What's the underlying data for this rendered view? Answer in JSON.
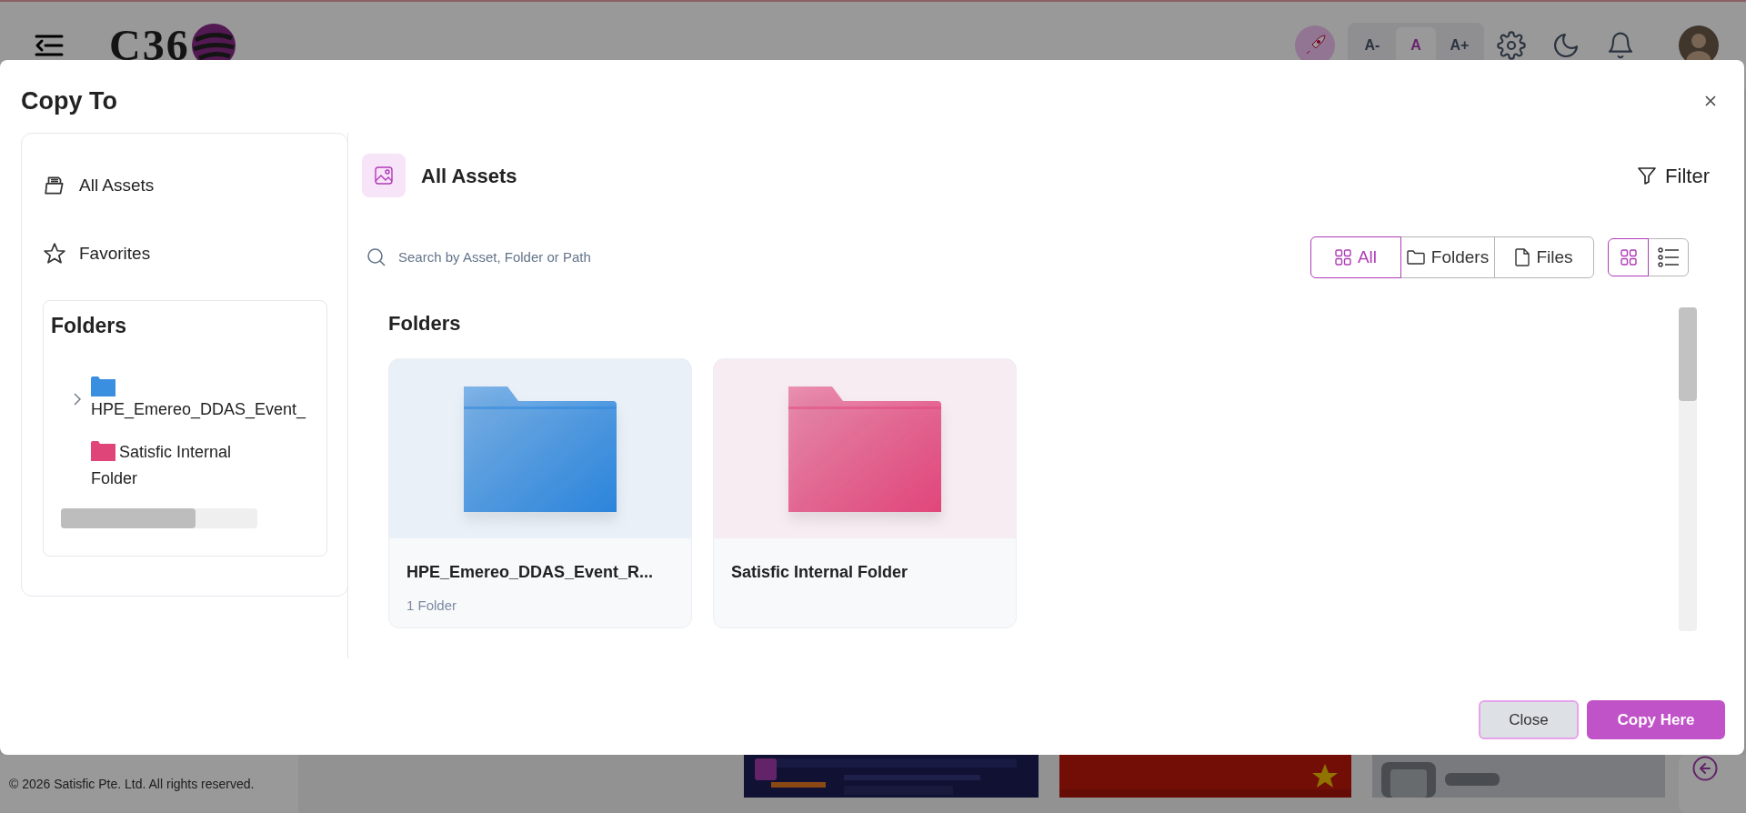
{
  "header": {
    "logo_text": "C36",
    "font_sizes": [
      {
        "label": "A-",
        "selected": false
      },
      {
        "label": "A",
        "selected": true
      },
      {
        "label": "A+",
        "selected": false
      }
    ]
  },
  "dialog": {
    "title": "Copy To",
    "sidebar": {
      "items": [
        {
          "label": "All Assets",
          "kind": "assets"
        },
        {
          "label": "Favorites",
          "kind": "favorites"
        }
      ],
      "folders_title": "Folders",
      "tree": [
        {
          "name": "HPE_Emereo_DDAS_Event_",
          "color": "#3b8fe0",
          "expandable": true
        },
        {
          "name": "Satisfic Internal Folder",
          "color": "#e0457a",
          "expandable": false
        }
      ]
    },
    "main": {
      "title": "All Assets",
      "filter": "Filter",
      "search": {
        "placeholder": "Search by Asset, Folder or Path"
      },
      "type_filters": [
        {
          "label": "All",
          "kind": "all",
          "selected": true
        },
        {
          "label": "Folders",
          "kind": "folders",
          "selected": false
        },
        {
          "label": "Files",
          "kind": "files",
          "selected": false
        }
      ],
      "view_modes": [
        {
          "kind": "grid",
          "selected": true
        },
        {
          "kind": "list",
          "selected": false
        }
      ],
      "section_title": "Folders",
      "folders": [
        {
          "name": "HPE_Emereo_DDAS_Event_R...",
          "subtitle": "1 Folder",
          "color": "#2a84db"
        },
        {
          "name": "Satisfic Internal Folder",
          "color": "#e0457a"
        }
      ]
    },
    "buttons": [
      {
        "label": "Close",
        "kind": "secondary"
      },
      {
        "label": "Copy Here",
        "kind": "primary"
      }
    ]
  },
  "footer": {
    "copyright": "© 2026 Satisfic Pte. Ltd. All rights reserved."
  }
}
